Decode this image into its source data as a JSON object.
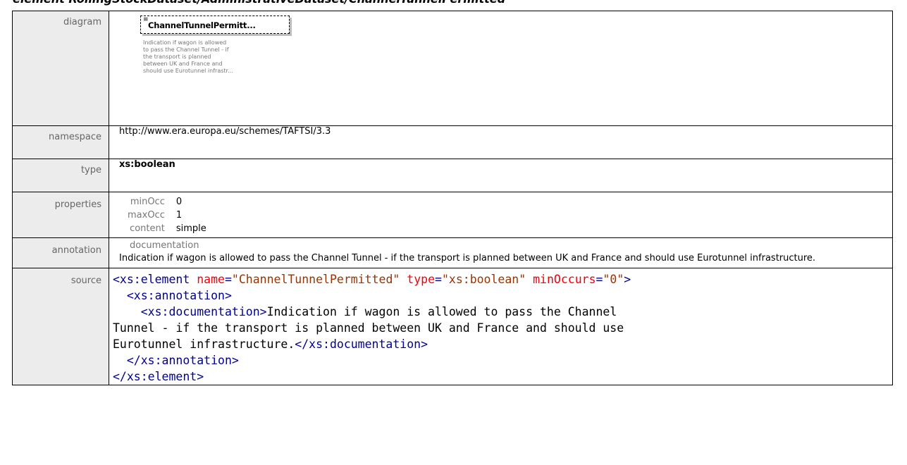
{
  "page_title": "element RollingStockDataset/AdministrativeDataset/ChannelTunnelPermitted",
  "labels": {
    "diagram": "diagram",
    "namespace": "namespace",
    "type": "type",
    "properties": "properties",
    "annotation": "annotation",
    "source": "source"
  },
  "diagram": {
    "element_name": "ChannelTunnelPermitt...",
    "doc_lines": [
      "Indication if wagon is allowed",
      "to pass the Channel Tunnel - if",
      "the transport is planned",
      "between UK and France and",
      "should use Eurotunnel infrastr..."
    ]
  },
  "namespace": "http://www.era.europa.eu/schemes/TAFTSI/3.3",
  "type": "xs:boolean",
  "properties": [
    {
      "key": "minOcc",
      "value": "0"
    },
    {
      "key": "maxOcc",
      "value": "1"
    },
    {
      "key": "content",
      "value": "simple"
    }
  ],
  "annotation": {
    "key": "documentation",
    "text": "Indication if wagon is allowed to pass the Channel Tunnel - if the transport is planned between UK and France and should use Eurotunnel infrastructure."
  },
  "source": {
    "open_tag": "<xs:element",
    "name_attr": "name",
    "name_val": "\"ChannelTunnelPermitted\"",
    "type_attr": "type",
    "type_val": "\"xs:boolean\"",
    "minocc_attr": "minOccurs",
    "minocc_val": "\"0\"",
    "annotation_open": "<xs:annotation>",
    "doc_open": "<xs:documentation>",
    "doc_text_1": "Indication if wagon is allowed to pass the Channel",
    "doc_text_2": "Tunnel - if the transport is planned between UK and France and should use",
    "doc_text_3": "Eurotunnel infrastructure.",
    "doc_close": "</xs:documentation>",
    "annotation_close": "</xs:annotation>",
    "element_close": "</xs:element>"
  }
}
